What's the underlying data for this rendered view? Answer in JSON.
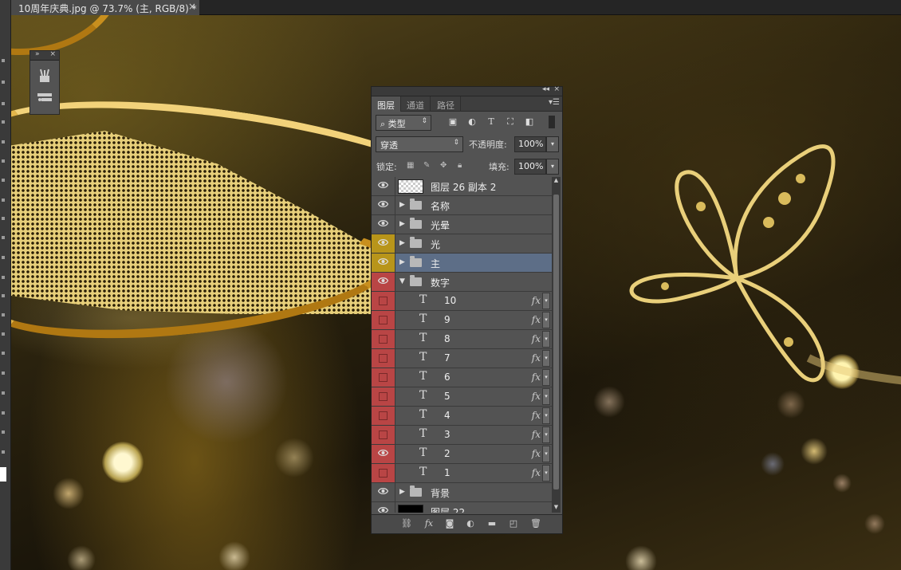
{
  "document": {
    "tab_title": "10周年庆典.jpg @ 73.7% (主, RGB/8) *",
    "close_glyph": "×"
  },
  "mini_panel": {
    "collapse_glyph": "»",
    "close_glyph": "×",
    "icons": [
      "brush-presets-icon",
      "clone-source-icon"
    ]
  },
  "layers_panel": {
    "collapse_glyph": "◂◂",
    "close_glyph": "×",
    "tabs": [
      {
        "label": "图层",
        "active": true
      },
      {
        "label": "通道",
        "active": false
      },
      {
        "label": "路径",
        "active": false
      }
    ],
    "filter": {
      "kind_label": "类型",
      "search_glyph": "⌕"
    },
    "blend_mode": "穿透",
    "opacity_label": "不透明度:",
    "opacity_value": "100%",
    "lock_label": "锁定:",
    "fill_label": "填充:",
    "fill_value": "100%",
    "layers": [
      {
        "name": "图层 26 副本 2",
        "type": "pixel",
        "thumb": "checker",
        "visible": true,
        "color": "none",
        "selected": false,
        "expanded": false,
        "indent": 0,
        "fx": false
      },
      {
        "name": "名称",
        "type": "group",
        "visible": true,
        "color": "none",
        "selected": false,
        "expanded": false,
        "indent": 0,
        "fx": false
      },
      {
        "name": "光晕",
        "type": "group",
        "visible": true,
        "color": "none",
        "selected": false,
        "expanded": false,
        "indent": 0,
        "fx": false
      },
      {
        "name": "光",
        "type": "group",
        "visible": true,
        "color": "yellow",
        "selected": false,
        "expanded": false,
        "indent": 0,
        "fx": false
      },
      {
        "name": "主",
        "type": "group",
        "visible": true,
        "color": "yellow",
        "selected": true,
        "expanded": false,
        "indent": 0,
        "fx": false
      },
      {
        "name": "数字",
        "type": "group",
        "visible": true,
        "color": "red",
        "selected": false,
        "expanded": true,
        "indent": 0,
        "fx": false
      },
      {
        "name": "10",
        "type": "text",
        "visible": false,
        "color": "red",
        "selected": false,
        "indent": 1,
        "fx": true
      },
      {
        "name": "9",
        "type": "text",
        "visible": false,
        "color": "red",
        "selected": false,
        "indent": 1,
        "fx": true
      },
      {
        "name": "8",
        "type": "text",
        "visible": false,
        "color": "red",
        "selected": false,
        "indent": 1,
        "fx": true
      },
      {
        "name": "7",
        "type": "text",
        "visible": false,
        "color": "red",
        "selected": false,
        "indent": 1,
        "fx": true
      },
      {
        "name": "6",
        "type": "text",
        "visible": false,
        "color": "red",
        "selected": false,
        "indent": 1,
        "fx": true
      },
      {
        "name": "5",
        "type": "text",
        "visible": false,
        "color": "red",
        "selected": false,
        "indent": 1,
        "fx": true
      },
      {
        "name": "4",
        "type": "text",
        "visible": false,
        "color": "red",
        "selected": false,
        "indent": 1,
        "fx": true
      },
      {
        "name": "3",
        "type": "text",
        "visible": false,
        "color": "red",
        "selected": false,
        "indent": 1,
        "fx": true
      },
      {
        "name": "2",
        "type": "text",
        "visible": true,
        "color": "red",
        "selected": false,
        "indent": 1,
        "fx": true
      },
      {
        "name": "1",
        "type": "text",
        "visible": false,
        "color": "red",
        "selected": false,
        "indent": 1,
        "fx": true
      },
      {
        "name": "背景",
        "type": "group",
        "visible": true,
        "color": "none",
        "selected": false,
        "expanded": false,
        "indent": 0,
        "fx": false
      },
      {
        "name": "图层 22",
        "type": "pixel",
        "thumb": "black",
        "visible": true,
        "color": "none",
        "selected": false,
        "expanded": false,
        "indent": 0,
        "fx": false
      }
    ],
    "fx_label": "fx",
    "footer_buttons": [
      "link-layers-icon",
      "add-style-icon",
      "add-mask-icon",
      "adjustment-layer-icon",
      "new-group-icon",
      "new-layer-icon",
      "delete-layer-icon"
    ]
  },
  "colors": {
    "label_red": "#b94545",
    "label_yellow": "#b8951a",
    "selected_row": "#5d6e87",
    "panel_bg": "#535353"
  }
}
